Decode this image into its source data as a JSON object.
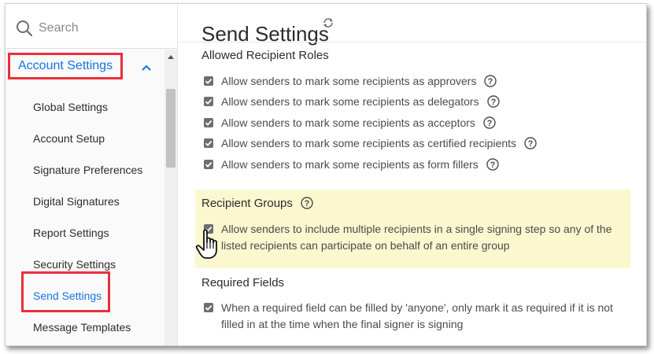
{
  "sidebar": {
    "search_placeholder": "Search",
    "section_title": "Account Settings",
    "items": [
      {
        "label": "Global Settings"
      },
      {
        "label": "Account Setup"
      },
      {
        "label": "Signature Preferences"
      },
      {
        "label": "Digital Signatures"
      },
      {
        "label": "Report Settings"
      },
      {
        "label": "Security Settings"
      },
      {
        "label": "Send Settings",
        "active": true
      },
      {
        "label": "Message Templates"
      }
    ]
  },
  "main": {
    "title": "Send Settings",
    "allowed_roles": {
      "heading": "Allowed Recipient Roles",
      "options": [
        {
          "label": "Allow senders to mark some recipients as approvers",
          "checked": true
        },
        {
          "label": "Allow senders to mark some recipients as delegators",
          "checked": true
        },
        {
          "label": "Allow senders to mark some recipients as acceptors",
          "checked": true
        },
        {
          "label": "Allow senders to mark some recipients as certified recipients",
          "checked": true
        },
        {
          "label": "Allow senders to mark some recipients as form fillers",
          "checked": true
        }
      ]
    },
    "recipient_groups": {
      "heading": "Recipient Groups",
      "option": {
        "label": "Allow senders to include multiple recipients in a single signing step so any of the listed recipients can participate on behalf of an entire group",
        "checked": true
      }
    },
    "required_fields": {
      "heading": "Required Fields",
      "option": {
        "label": "When a required field can be filled by 'anyone', only mark it as required if it is not filled in at the time when the final signer is signing",
        "checked": true
      }
    }
  },
  "colors": {
    "accent": "#1473e6",
    "callout_red": "#e8303b",
    "highlight": "#fbf7cf"
  },
  "icons": [
    "search-icon",
    "chevron-up-icon",
    "refresh-icon",
    "help-icon",
    "checkmark-icon",
    "hand-cursor-icon"
  ]
}
